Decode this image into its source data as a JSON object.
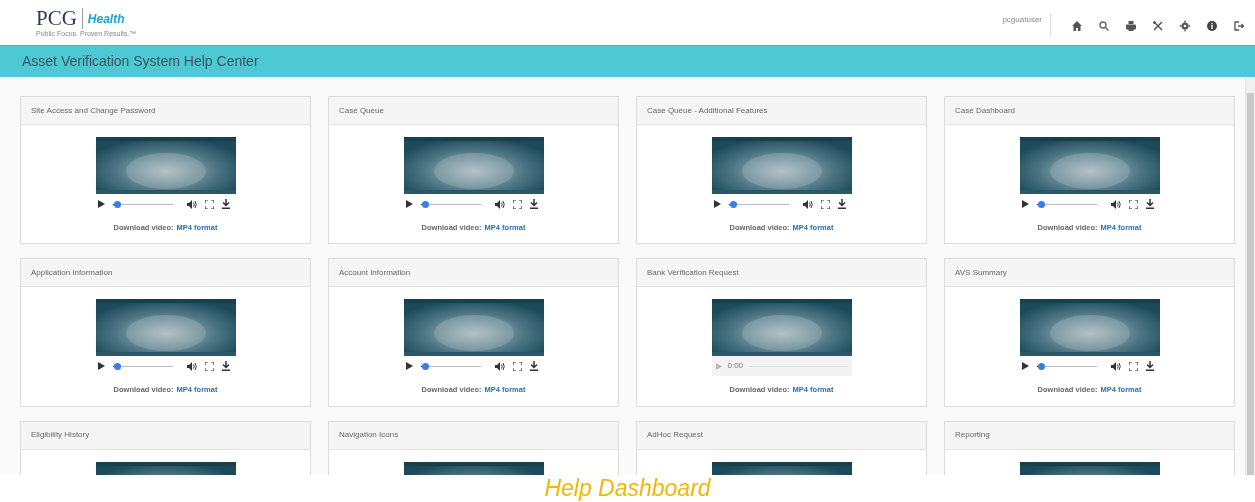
{
  "header": {
    "logo": {
      "brand": "PCG",
      "product": "Health",
      "tagline": "Public Focus. Proven Results.™"
    },
    "username": "pcguatuser"
  },
  "banner": {
    "title": "Asset Verification System Help Center"
  },
  "videos": [
    {
      "title": "Site Access and Change Password",
      "player": {
        "kind": "controls",
        "level": 0.08
      },
      "download_label": "Download video:",
      "download_link": "MP4 format"
    },
    {
      "title": "Case Queue",
      "player": {
        "kind": "controls",
        "level": 0.08
      },
      "download_label": "Download video:",
      "download_link": "MP4 format"
    },
    {
      "title": "Case Queue - Additional Features",
      "player": {
        "kind": "controls",
        "level": 0.08
      },
      "download_label": "Download video:",
      "download_link": "MP4 format"
    },
    {
      "title": "Case Dashboard",
      "player": {
        "kind": "controls",
        "level": 0.08
      },
      "download_label": "Download video:",
      "download_link": "MP4 format"
    },
    {
      "title": "Application Information",
      "player": {
        "kind": "controls",
        "level": 0.08
      },
      "download_label": "Download video:",
      "download_link": "MP4 format"
    },
    {
      "title": "Account Information",
      "player": {
        "kind": "controls",
        "level": 0.08
      },
      "download_label": "Download video:",
      "download_link": "MP4 format"
    },
    {
      "title": "Bank Verification Request",
      "player": {
        "kind": "idle",
        "time": "0:00"
      },
      "download_label": "Download video:",
      "download_link": "MP4 format"
    },
    {
      "title": "AVS Summary",
      "player": {
        "kind": "controls",
        "level": 0.08
      },
      "download_label": "Download video:",
      "download_link": "MP4 format"
    },
    {
      "title": "Eligibility History"
    },
    {
      "title": "Navigation Icons"
    },
    {
      "title": "AdHoc Request"
    },
    {
      "title": "Reporting"
    }
  ],
  "caption": "Help Dashboard"
}
